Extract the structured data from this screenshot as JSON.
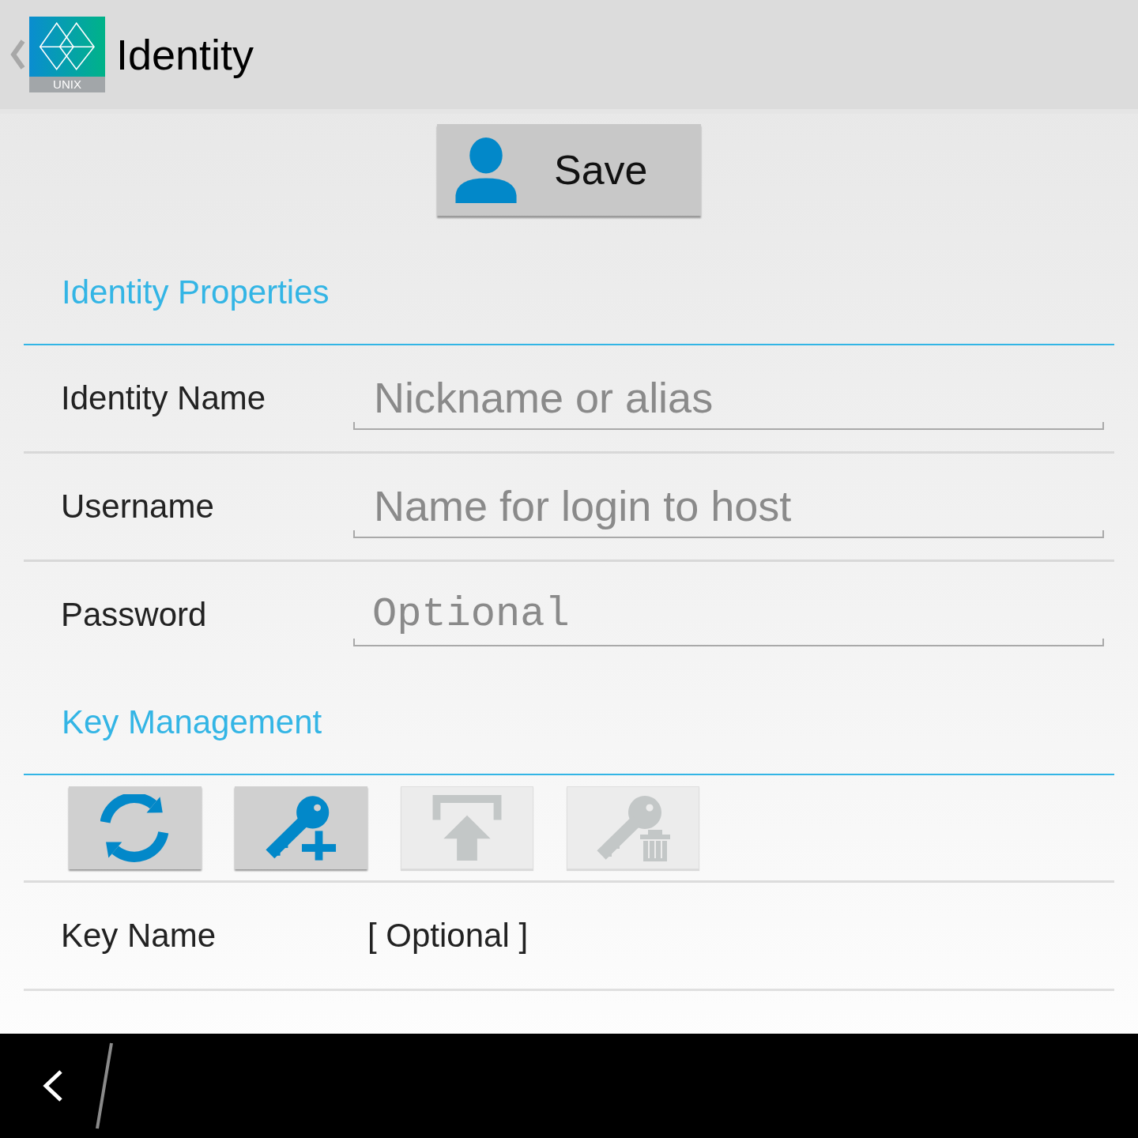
{
  "action_bar": {
    "title": "Identity",
    "logo_caption": "UNIX"
  },
  "save_button": {
    "label": "Save"
  },
  "identity_properties": {
    "title": "Identity Properties",
    "fields": [
      {
        "kind": "text",
        "label": "Identity Name",
        "placeholder": "Nickname or alias"
      },
      {
        "kind": "text",
        "label": "Username",
        "placeholder": "Name for login to host"
      },
      {
        "kind": "password",
        "label": "Password",
        "placeholder": "Optional"
      }
    ]
  },
  "key_management": {
    "title": "Key Management",
    "actions": [
      {
        "kind": "refresh",
        "disabled": false
      },
      {
        "kind": "add_key",
        "disabled": false
      },
      {
        "kind": "upload",
        "disabled": true
      },
      {
        "kind": "delete_key",
        "disabled": true
      }
    ],
    "key_name": {
      "label": "Key Name",
      "value": "[ Optional ]"
    }
  }
}
